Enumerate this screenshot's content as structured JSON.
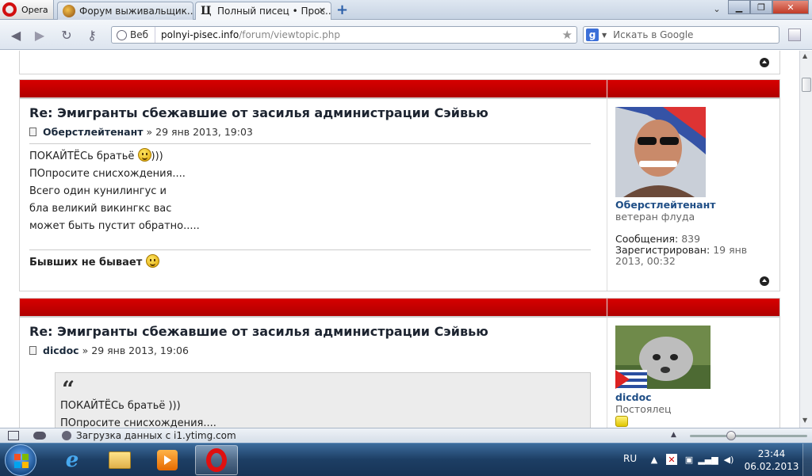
{
  "browser": {
    "menu_label": "Opera",
    "tabs": [
      {
        "title": "Форум выживальщик..."
      },
      {
        "title": "Полный писец • Прос..."
      }
    ],
    "address": {
      "badge": "Веб",
      "host": "polnyi-pisec.info",
      "path": "/forum/viewtopic.php"
    },
    "search_placeholder": "Искать в Google",
    "status_text": "Загрузка данных с i1.ytimg.com"
  },
  "posts": [
    {
      "title": "Re: Эмигранты сбежавшие от засилья администрации Сэйвью",
      "author": "Оберстлейтенант",
      "date": "29 янв 2013, 19:03",
      "lines": [
        "ПОКАЙТЁСь братьё",
        ")))",
        "ПОпросите снисхождения....",
        "Всего один кунилингус и",
        "бла великий викингкс вас",
        "может быть пустит обратно....."
      ],
      "signature": "Бывших не бывает",
      "profile": {
        "name": "Оберстлейтенант",
        "rank": "ветеран флуда",
        "messages_label": "Сообщения:",
        "messages_value": "839",
        "registered_label": "Зарегистрирован:",
        "registered_value": "19 янв 2013, 00:32"
      }
    },
    {
      "title": "Re: Эмигранты сбежавшие от засилья администрации Сэйвью",
      "author": "dicdoc",
      "date": "29 янв 2013, 19:06",
      "quote_lines": [
        "ПОКАЙТЁСь братьё )))",
        "ПОпросите снисхождения...."
      ],
      "profile": {
        "name": "dicdoc",
        "rank": "Постоялец"
      }
    }
  ],
  "taskbar": {
    "lang": "RU",
    "time": "23:44",
    "date": "06.02.2013"
  },
  "colors": {
    "post_bar": "#c40000",
    "link": "#1f4e86",
    "taskbar": "#1d3e64"
  }
}
